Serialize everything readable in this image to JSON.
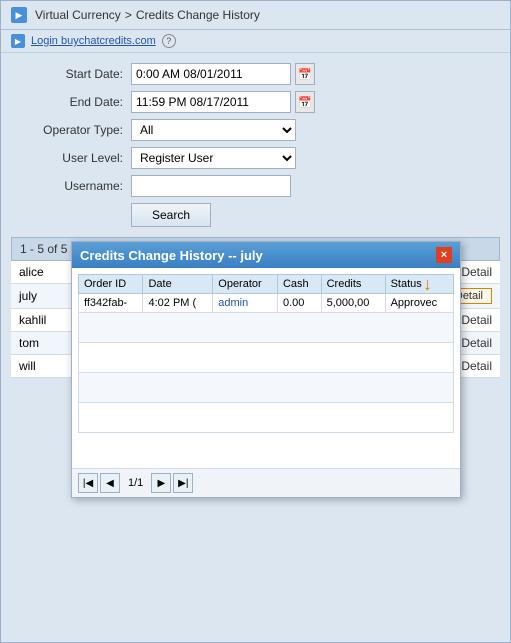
{
  "breadcrumb": {
    "parent": "Virtual Currency",
    "separator": ">",
    "current": "Credits Change History"
  },
  "loginBar": {
    "icon": "▶",
    "label": "Login buychatcredits.com",
    "helpBadge": "?"
  },
  "form": {
    "startDateLabel": "Start Date:",
    "startDateValue": "0:00 AM 08/01/2011",
    "endDateLabel": "End Date:",
    "endDateValue": "11:59 PM 08/17/2011",
    "operatorTypeLabel": "Operator Type:",
    "operatorTypeValue": "All",
    "operatorTypeOptions": [
      "All"
    ],
    "userLevelLabel": "User Level:",
    "userLevelValue": "Register User",
    "userLevelOptions": [
      "Register User"
    ],
    "usernameLabel": "Username:",
    "usernamePlaceholder": "",
    "searchButton": "Search"
  },
  "results": {
    "summary": "1 - 5 of 5",
    "rows": [
      {
        "name": "alice",
        "detailLabel": "Detail",
        "highlighted": false
      },
      {
        "name": "july",
        "detailLabel": "Detail",
        "highlighted": true
      },
      {
        "name": "kahlil",
        "detailLabel": "Detail",
        "highlighted": false
      },
      {
        "name": "tom",
        "detailLabel": "Detail",
        "highlighted": false
      },
      {
        "name": "will",
        "detailLabel": "Detail",
        "highlighted": false
      }
    ]
  },
  "modal": {
    "title": "Credits Change History -- july",
    "closeBtn": "×",
    "columns": [
      "Order ID",
      "Date",
      "Operator",
      "Cash",
      "Credits",
      "Status"
    ],
    "rows": [
      {
        "orderId": "ff342fab-",
        "date": "4:02 PM (",
        "operator": "admin",
        "cash": "0.00",
        "credits": "5,000,00",
        "status": "Approvec"
      }
    ],
    "pagination": {
      "firstBtn": "|◀",
      "prevBtn": "◀",
      "pageInfo": "1/1",
      "nextBtn": "▶",
      "lastBtn": "▶|"
    },
    "closeButton": "Close"
  }
}
